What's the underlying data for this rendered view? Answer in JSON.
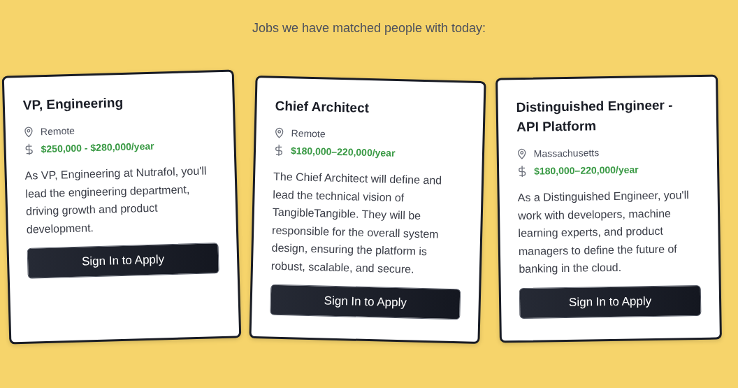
{
  "heading": "Jobs we have matched people with today:",
  "jobs": [
    {
      "title": "VP, Engineering",
      "location": "Remote",
      "salary": "$250,000 - $280,000/year",
      "description": "As VP, Engineering at Nutrafol, you'll lead the engineering department, driving growth and product development.",
      "button": "Sign In to Apply"
    },
    {
      "title": "Chief Architect",
      "location": "Remote",
      "salary": "$180,000–220,000/year",
      "description": "The Chief Architect will define and lead the technical vision of TangibleTangible. They will be responsible for the overall system design, ensuring the platform is robust, scalable, and secure.",
      "button": "Sign In to Apply"
    },
    {
      "title": "Distinguished Engineer - API Platform",
      "location": "Massachusetts",
      "salary": "$180,000–220,000/year",
      "description": "As a Distinguished Engineer, you'll work with developers, machine learning experts, and product managers to define the future of banking in the cloud.",
      "button": "Sign In to Apply"
    }
  ]
}
